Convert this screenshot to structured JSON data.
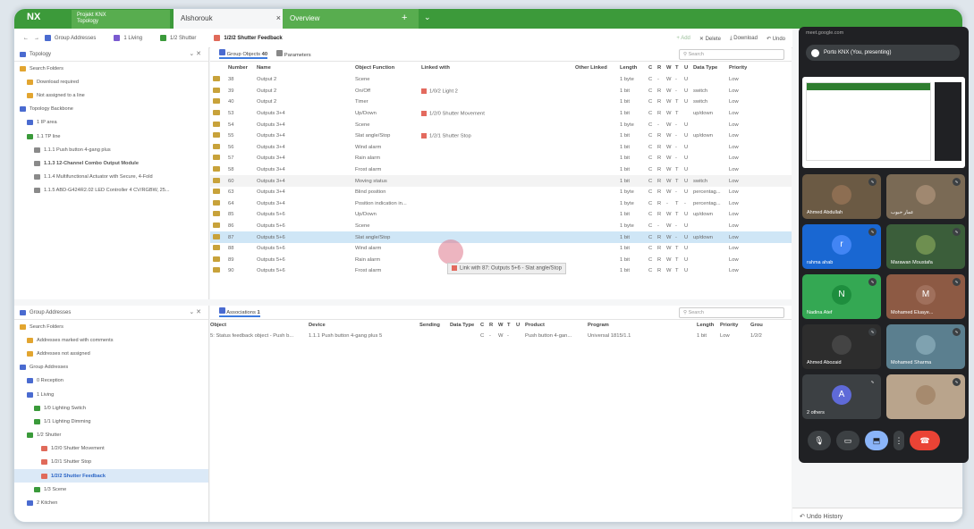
{
  "app": {
    "logo": "NX",
    "project": [
      "Projekt KNX",
      "Topology"
    ],
    "tabs": [
      "Alshorouk",
      "Overview"
    ],
    "tab_close": "×",
    "tab_plus": "+",
    "tab_chev": "⌄"
  },
  "breadcrumbs": [
    "Group Addresses",
    "1 Living",
    "1/2 Shutter",
    "1/2/2 Shutter Feedback"
  ],
  "toolbar": {
    "add": "+ Add",
    "delete": "✕ Delete",
    "download": "⤓ Download",
    "undo": "↶ Undo"
  },
  "topology": {
    "title": "Topology",
    "items": [
      {
        "label": "Search Folders",
        "ico": "fold",
        "ind": 0
      },
      {
        "label": "Download required",
        "ico": "fold",
        "ind": 1
      },
      {
        "label": "Not assigned to a line",
        "ico": "fold",
        "ind": 1
      },
      {
        "label": "Topology Backbone",
        "ico": "blu",
        "ind": 0
      },
      {
        "label": "1 IP area",
        "ico": "blu",
        "ind": 1
      },
      {
        "label": "1.1 TP line",
        "ico": "grn",
        "ind": 1
      },
      {
        "label": "1.1.1 Push button 4-gang plus",
        "ico": "gry",
        "ind": 2
      },
      {
        "label": "1.1.3 12-Channel Combo Output Module",
        "ico": "gry",
        "ind": 2,
        "bold": true
      },
      {
        "label": "1.1.4 Multifunctional Actuator with Secure, 4-Fold",
        "ico": "gry",
        "ind": 2
      },
      {
        "label": "1.1.5 ABD-G424R2.02 LED Controller 4 CV/RGBW, 25...",
        "ico": "gry",
        "ind": 2
      }
    ]
  },
  "groupaddr": {
    "title": "Group Addresses",
    "items": [
      {
        "label": "Search Folders",
        "ico": "fold",
        "ind": 0
      },
      {
        "label": "Addresses marked with comments",
        "ico": "fold",
        "ind": 1
      },
      {
        "label": "Addresses not assigned",
        "ico": "fold",
        "ind": 1
      },
      {
        "label": "Group Addresses",
        "ico": "blu",
        "ind": 0
      },
      {
        "label": "0 Reception",
        "ico": "blu",
        "ind": 1
      },
      {
        "label": "1 Living",
        "ico": "blu",
        "ind": 1
      },
      {
        "label": "1/0 Lighting Switch",
        "ico": "grn",
        "ind": 2
      },
      {
        "label": "1/1 Lighting Dimming",
        "ico": "grn",
        "ind": 2
      },
      {
        "label": "1/2 Shutter",
        "ico": "grn",
        "ind": 1
      },
      {
        "label": "1/2/0 Shutter Movement",
        "ico": "red",
        "ind": 3
      },
      {
        "label": "1/2/1 Shutter Stop",
        "ico": "red",
        "ind": 3
      },
      {
        "label": "1/2/2 Shutter Feedback",
        "ico": "red",
        "ind": 3,
        "sel": true
      },
      {
        "label": "1/3 Scene",
        "ico": "grn",
        "ind": 2
      },
      {
        "label": "2 Kitchen",
        "ico": "blu",
        "ind": 1
      }
    ]
  },
  "gobj": {
    "tab1": "Group Objects",
    "count": "40",
    "tab2": "Parameters",
    "search": "Search",
    "headers": [
      "",
      "Number",
      "Name",
      "Object Function",
      "Linked with",
      "Other Linked",
      "Length",
      "C",
      "R",
      "W",
      "T",
      "U",
      "Data Type",
      "Priority"
    ],
    "rows": [
      [
        "38",
        "Output 2",
        "Scene",
        "",
        "",
        "1 byte",
        "C",
        "-",
        "W",
        "-",
        "U",
        "",
        "Low"
      ],
      [
        "39",
        "Output 2",
        "On/Off",
        "1/0/2 Light 2",
        "",
        "1 bit",
        "C",
        "R",
        "W",
        "-",
        "U",
        "switch",
        "Low"
      ],
      [
        "40",
        "Output 2",
        "Timer",
        "",
        "",
        "1 bit",
        "C",
        "R",
        "W",
        "T",
        "U",
        "switch",
        "Low"
      ],
      [
        "53",
        "Outputs 3+4",
        "Up/Down",
        "1/2/0 Shutter Movement",
        "",
        "1 bit",
        "C",
        "R",
        "W",
        "T",
        "",
        "up/down",
        "Low"
      ],
      [
        "54",
        "Outputs 3+4",
        "Scene",
        "",
        "",
        "1 byte",
        "C",
        "-",
        "W",
        "-",
        "U",
        "",
        "Low"
      ],
      [
        "55",
        "Outputs 3+4",
        "Slat angle/Stop",
        "1/2/1 Shutter Stop",
        "",
        "1 bit",
        "C",
        "R",
        "W",
        "-",
        "U",
        "up/down",
        "Low"
      ],
      [
        "56",
        "Outputs 3+4",
        "Wind alarm",
        "",
        "",
        "1 bit",
        "C",
        "R",
        "W",
        "-",
        "U",
        "",
        "Low"
      ],
      [
        "57",
        "Outputs 3+4",
        "Rain alarm",
        "",
        "",
        "1 bit",
        "C",
        "R",
        "W",
        "-",
        "U",
        "",
        "Low"
      ],
      [
        "58",
        "Outputs 3+4",
        "Frost alarm",
        "",
        "",
        "1 bit",
        "C",
        "R",
        "W",
        "T",
        "U",
        "",
        "Low"
      ],
      [
        "60",
        "Outputs 3+4",
        "Moving status",
        "",
        "",
        "1 bit",
        "C",
        "R",
        "W",
        "T",
        "U",
        "switch",
        "Low"
      ],
      [
        "63",
        "Outputs 3+4",
        "Blind position",
        "",
        "",
        "1 byte",
        "C",
        "R",
        "W",
        "-",
        "U",
        "percentag...",
        "Low"
      ],
      [
        "64",
        "Outputs 3+4",
        "Position indication in...",
        "",
        "",
        "1 byte",
        "C",
        "R",
        "-",
        "T",
        "-",
        "percentag...",
        "Low"
      ],
      [
        "85",
        "Outputs 5+6",
        "Up/Down",
        "",
        "",
        "1 bit",
        "C",
        "R",
        "W",
        "T",
        "U",
        "up/down",
        "Low"
      ],
      [
        "86",
        "Outputs 5+6",
        "Scene",
        "",
        "",
        "1 byte",
        "C",
        "-",
        "W",
        "-",
        "U",
        "",
        "Low"
      ],
      [
        "87",
        "Outputs 5+6",
        "Slat angle/Stop",
        "",
        "",
        "1 bit",
        "C",
        "R",
        "W",
        "-",
        "U",
        "up/down",
        "Low"
      ],
      [
        "88",
        "Outputs 5+6",
        "Wind alarm",
        "",
        "",
        "1 bit",
        "C",
        "R",
        "W",
        "T",
        "U",
        "",
        "Low"
      ],
      [
        "89",
        "Outputs 5+6",
        "Rain alarm",
        "",
        "",
        "1 bit",
        "C",
        "R",
        "W",
        "T",
        "U",
        "",
        "Low"
      ],
      [
        "90",
        "Outputs 5+6",
        "Frost alarm",
        "",
        "",
        "1 bit",
        "C",
        "R",
        "W",
        "T",
        "U",
        "",
        "Low"
      ]
    ],
    "tooltip": "Link with 87: Outputs 5+6 - Slat angle/Stop"
  },
  "assoc": {
    "title": "Associations",
    "count": "1",
    "search": "Search",
    "headers": [
      "Object",
      "Device",
      "Sending",
      "Data Type",
      "C",
      "R",
      "W",
      "T",
      "U",
      "Product",
      "Program",
      "Length",
      "Priority",
      "Grou"
    ],
    "row": [
      "5: Status feedback object - Push b...",
      "1.1.1 Push button 4-gang plus 5",
      "",
      "",
      "C",
      "-",
      "W",
      "-",
      "",
      "Push button 4-gan...",
      "Universal 1815/1.1",
      "1 bit",
      "Low",
      "1/2/2"
    ]
  },
  "undo_history": "Undo History",
  "meet": {
    "url": "meet.google.com",
    "presenting": "Porto KNX (You, presenting)",
    "tiles": [
      {
        "name": "Ahmed Abdullah",
        "bg": "#6b5a44",
        "avatar": "",
        "avbg": "#8d6e52"
      },
      {
        "name": "عمار حبوب",
        "bg": "#7a6a55",
        "avatar": "",
        "avbg": "#a08870"
      },
      {
        "name": "rahma ahab",
        "bg": "#1967d2",
        "avatar": "r",
        "avbg": "#4285f4"
      },
      {
        "name": "Marawan Moustafa",
        "bg": "#3b5e3a",
        "avatar": "",
        "avbg": "#6e8f50"
      },
      {
        "name": "Nadina Atef",
        "bg": "#34a853",
        "avatar": "N",
        "avbg": "#1e8e3e"
      },
      {
        "name": "Mohamed Eluaye...",
        "bg": "#8d5a44",
        "avatar": "M",
        "avbg": "#a0705c"
      },
      {
        "name": "Ahmed Abozaid",
        "bg": "#2d2d2d",
        "avatar": "",
        "avbg": "#444"
      },
      {
        "name": "Mohamed Sharma",
        "bg": "#5b7f8f",
        "avatar": "",
        "avbg": "#7fa2b0"
      },
      {
        "name": "2 others",
        "bg": "#3c4043",
        "avatar": "A",
        "avbg": "#5f6ad8"
      },
      {
        "name": "",
        "bg": "#b9a48c",
        "avatar": "",
        "avbg": "#a68a6e"
      }
    ],
    "controls": [
      "🎙",
      "▭",
      "⬒",
      "⋮",
      "☎"
    ]
  }
}
